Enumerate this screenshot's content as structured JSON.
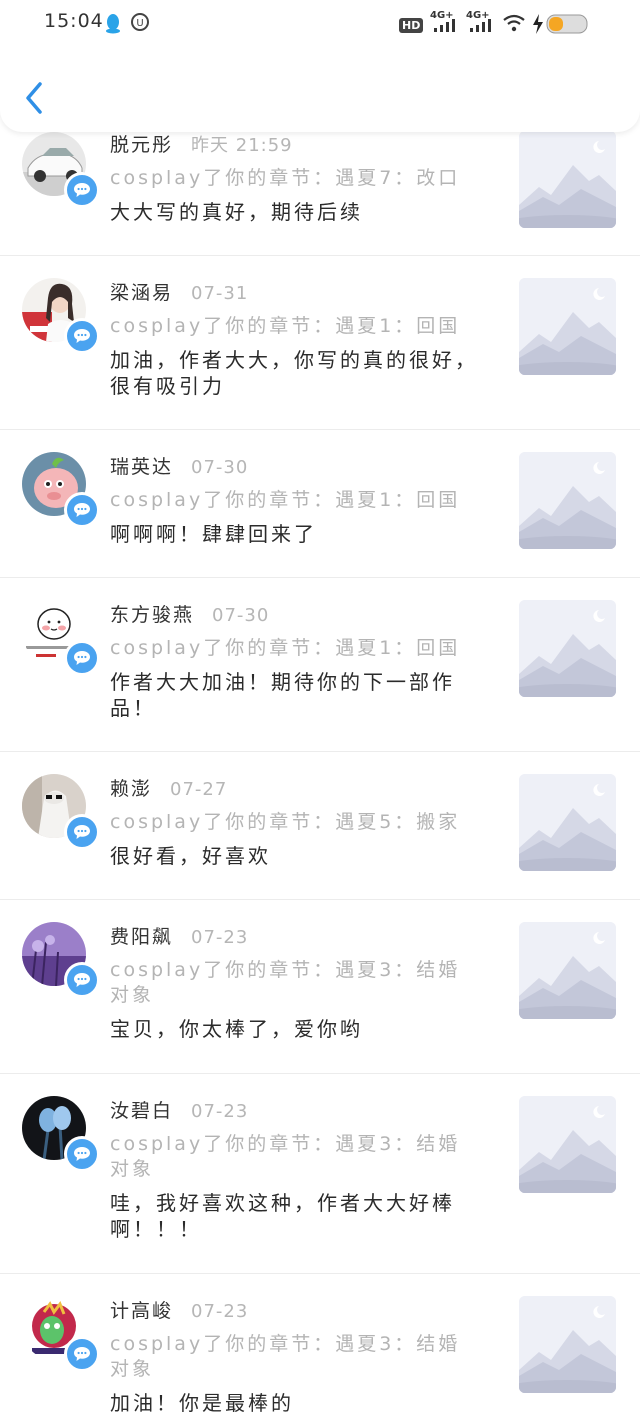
{
  "status_bar": {
    "time": "15:04",
    "hd_label": "HD",
    "network_1": "4G+",
    "network_2": "4G+"
  },
  "nav": {
    "back_icon": "chevron-left-icon",
    "accent": "#2f8fe6"
  },
  "badge_icon": "comment-bubble-icon",
  "comments": [
    {
      "name": "脱元彤",
      "time": "昨天 21:59",
      "target": "cosplay了你的章节：遇夏7：改口",
      "text": "大大写的真好，期待后续"
    },
    {
      "name": "梁涵易",
      "time": "07-31",
      "target": "cosplay了你的章节：遇夏1：回国",
      "text": "加油，作者大大，你写的真的很好，很有吸引力"
    },
    {
      "name": "瑞英达",
      "time": "07-30",
      "target": "cosplay了你的章节：遇夏1：回国",
      "text": "啊啊啊！肆肆回来了"
    },
    {
      "name": "东方骏燕",
      "time": "07-30",
      "target": "cosplay了你的章节：遇夏1：回国",
      "text": "作者大大加油！期待你的下一部作品！"
    },
    {
      "name": "赖澎",
      "time": "07-27",
      "target": "cosplay了你的章节：遇夏5：搬家",
      "text": "很好看，好喜欢"
    },
    {
      "name": "费阳飙",
      "time": "07-23",
      "target": "cosplay了你的章节：遇夏3：结婚对象",
      "text": "宝贝，你太棒了，爱你哟"
    },
    {
      "name": "汝碧白",
      "time": "07-23",
      "target": "cosplay了你的章节：遇夏3：结婚对象",
      "text": "哇，我好喜欢这种，作者大大好棒啊！！！"
    },
    {
      "name": "计高峻",
      "time": "07-23",
      "target": "cosplay了你的章节：遇夏3：结婚对象",
      "text": "加油！你是最棒的"
    }
  ]
}
